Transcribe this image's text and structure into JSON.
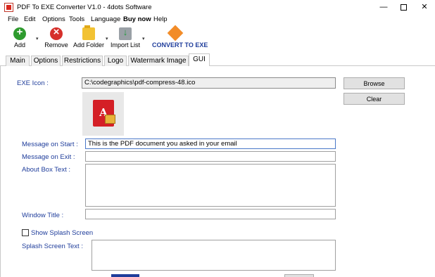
{
  "window": {
    "title": "PDF To EXE Converter V1.0 - 4dots Software",
    "minimize_glyph": "—",
    "close_glyph": "✕"
  },
  "menu": {
    "items": [
      "File",
      "Edit",
      "Options",
      "Tools",
      "Language",
      "Buy now",
      "Help"
    ]
  },
  "toolbar": {
    "add_label": "Add",
    "remove_label": "Remove",
    "add_folder_label": "Add Folder",
    "import_list_label": "Import List",
    "convert_label": "CONVERT TO EXE",
    "dropdown_glyph": "▾"
  },
  "tabs": [
    "Main",
    "Options",
    "Restrictions",
    "Logo",
    "Watermark Image",
    "GUI"
  ],
  "gui": {
    "exe_icon_label": "EXE Icon :",
    "exe_icon_path": "C:\\codegraphics\\pdf-compress-48.ico",
    "browse_label": "Browse",
    "clear_label": "Clear",
    "message_on_start_label": "Message on Start :",
    "message_on_start_value": "This is the PDF document you asked in your email",
    "message_on_exit_label": "Message on Exit :",
    "message_on_exit_value": "",
    "about_box_text_label": "About Box Text :",
    "about_box_text_value": "",
    "window_title_label": "Window Title :",
    "window_title_value": "",
    "show_splash_label": "Show Splash Screen",
    "show_splash_checked": false,
    "splash_text_label": "Splash Screen Text :",
    "splash_text_value": ""
  }
}
